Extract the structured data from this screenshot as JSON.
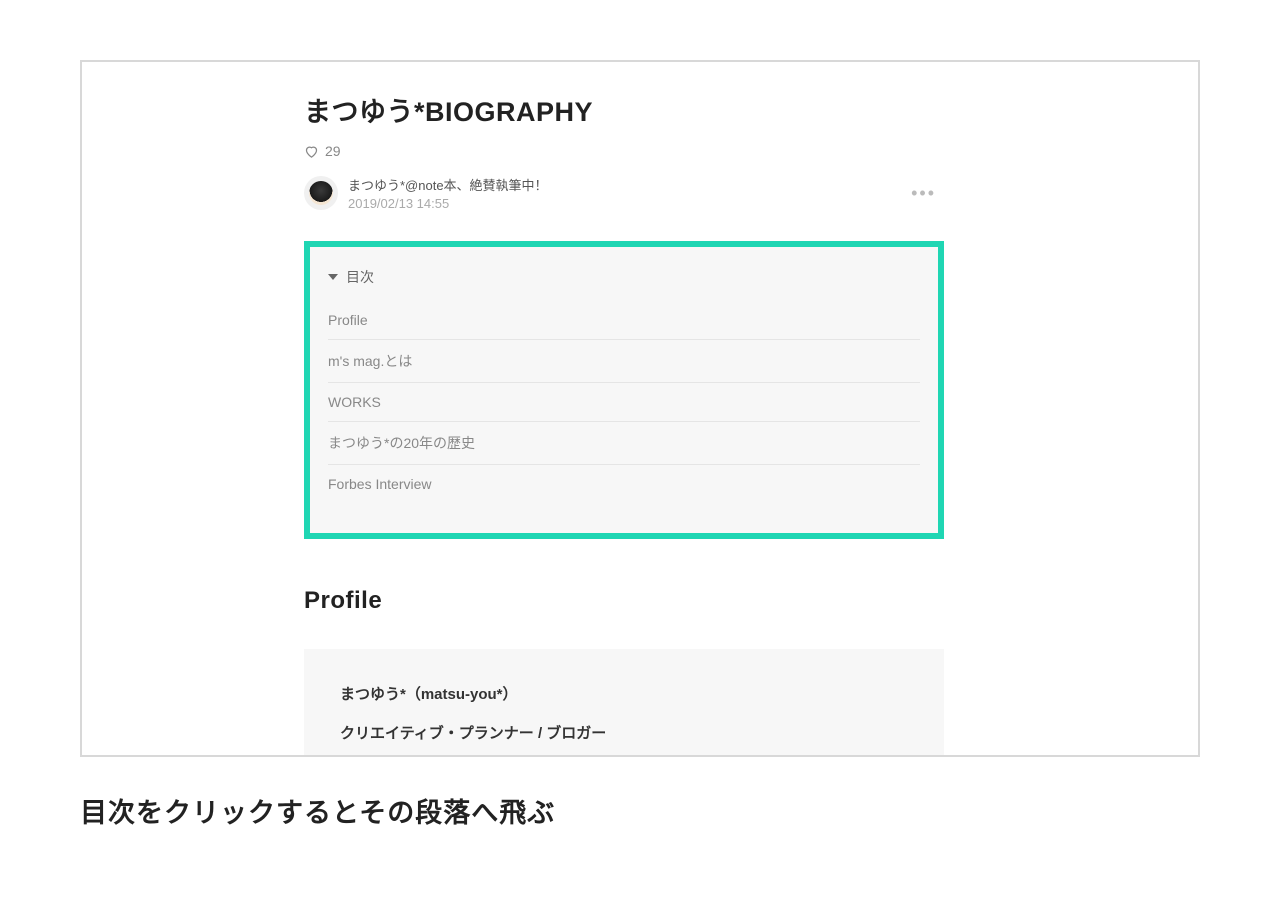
{
  "article": {
    "title": "まつゆう*BIOGRAPHY",
    "likes": "29",
    "author": {
      "name": "まつゆう*@note本、絶賛執筆中！",
      "date": "2019/02/13 14:55"
    },
    "toc": {
      "label": "目次",
      "items": [
        "Profile",
        "m's mag.とは",
        "WORKS",
        "まつゆう*の20年の歴史",
        "Forbes Interview"
      ]
    },
    "section": {
      "heading": "Profile",
      "profile_name": "まつゆう*（matsu-you*）",
      "profile_role": "クリエイティブ・プランナー / ブロガー"
    }
  },
  "caption": "目次をクリックするとその段落へ飛ぶ"
}
